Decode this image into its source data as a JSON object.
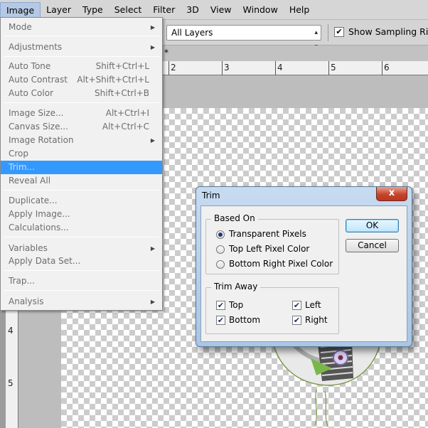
{
  "menubar": {
    "items": [
      {
        "label": "Image",
        "active": true
      },
      {
        "label": "Layer"
      },
      {
        "label": "Type"
      },
      {
        "label": "Select"
      },
      {
        "label": "Filter"
      },
      {
        "label": "3D"
      },
      {
        "label": "View"
      },
      {
        "label": "Window"
      },
      {
        "label": "Help"
      }
    ]
  },
  "options": {
    "sample_select": "All Layers",
    "show_sampling_ring_label": "Show Sampling Ring",
    "show_sampling_ring_checked": true
  },
  "tab": {
    "modified_marker": "*"
  },
  "ruler": {
    "h_labels": [
      "2",
      "3",
      "4",
      "5",
      "6"
    ],
    "v_labels": [
      "4",
      "5"
    ]
  },
  "image_menu": {
    "items": [
      {
        "label": "Mode",
        "submenu": true
      },
      {
        "label": "Adjustments",
        "submenu": true
      },
      {
        "label": "Auto Tone",
        "shortcut": "Shift+Ctrl+L"
      },
      {
        "label": "Auto Contrast",
        "shortcut": "Alt+Shift+Ctrl+L"
      },
      {
        "label": "Auto Color",
        "shortcut": "Shift+Ctrl+B"
      },
      {
        "label": "Image Size...",
        "shortcut": "Alt+Ctrl+I"
      },
      {
        "label": "Canvas Size...",
        "shortcut": "Alt+Ctrl+C"
      },
      {
        "label": "Image Rotation",
        "submenu": true
      },
      {
        "label": "Crop"
      },
      {
        "label": "Trim...",
        "highlighted": true
      },
      {
        "label": "Reveal All"
      },
      {
        "label": "Duplicate..."
      },
      {
        "label": "Apply Image..."
      },
      {
        "label": "Calculations..."
      },
      {
        "label": "Variables",
        "submenu": true
      },
      {
        "label": "Apply Data Set..."
      },
      {
        "label": "Trap..."
      },
      {
        "label": "Analysis",
        "submenu": true
      }
    ]
  },
  "dialog": {
    "title": "Trim",
    "close_label": "x",
    "based_on": {
      "label": "Based On",
      "options": [
        "Transparent Pixels",
        "Top Left Pixel Color",
        "Bottom Right Pixel Color"
      ],
      "selected": 0
    },
    "trim_away": {
      "label": "Trim Away",
      "top": "Top",
      "bottom": "Bottom",
      "left": "Left",
      "right": "Right"
    },
    "ok_label": "OK",
    "cancel_label": "Cancel"
  },
  "icons": {
    "check": "check-icon",
    "submenu": "triangle-right-icon",
    "dropdown": "updown-arrows-icon"
  },
  "colors": {
    "highlight": "#3399ff",
    "dialog_frame": "#a9c6e6",
    "close_button": "#c7432b"
  }
}
